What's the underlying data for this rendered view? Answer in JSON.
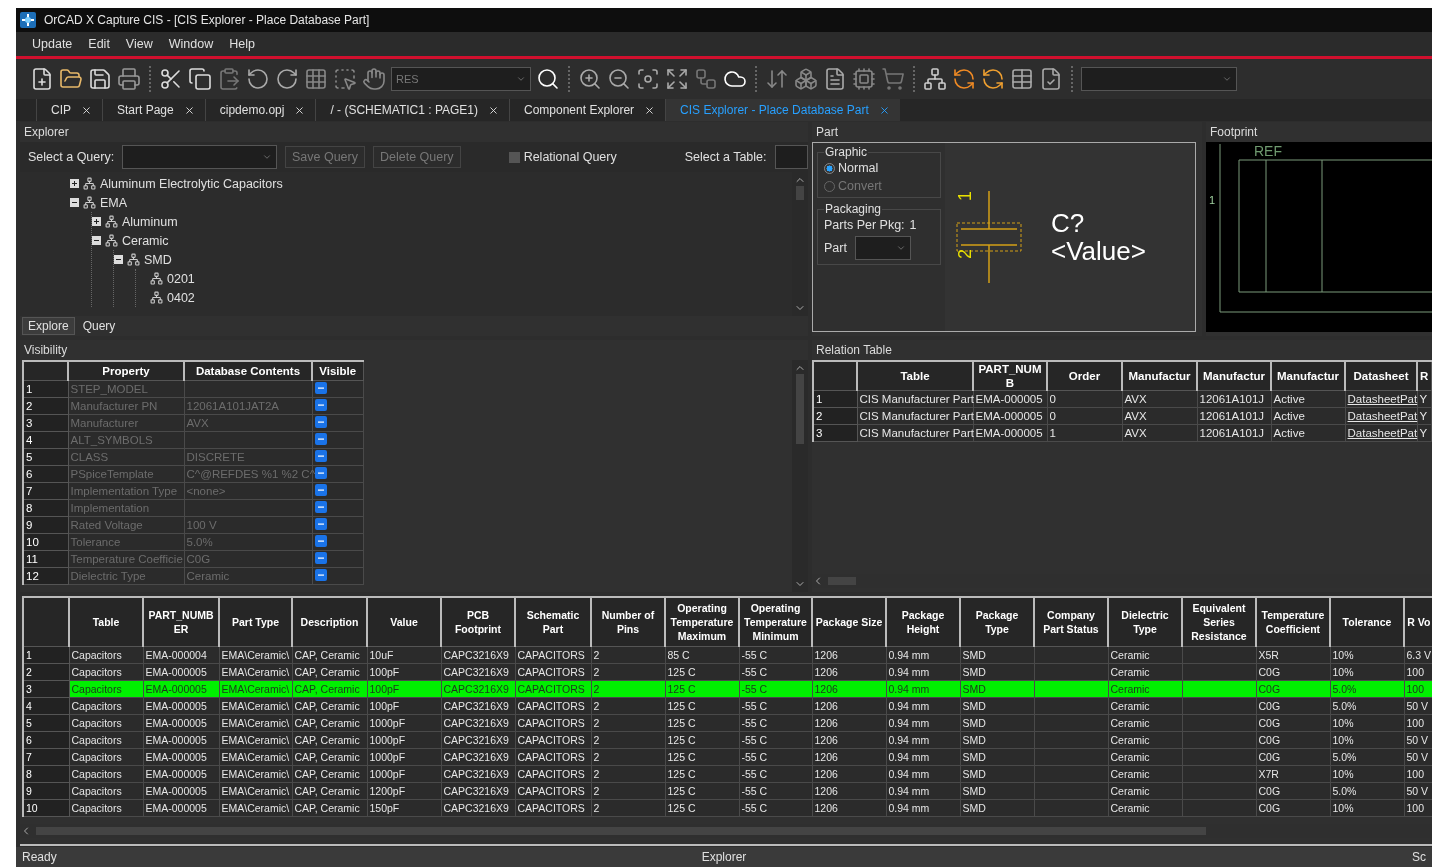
{
  "window": {
    "title": "OrCAD X Capture CIS - [CIS Explorer - Place Database Part]"
  },
  "menu": [
    "Update",
    "Edit",
    "View",
    "Window",
    "Help"
  ],
  "toolbar": {
    "search_value": "RES"
  },
  "tabs": [
    {
      "label": "CIP",
      "selected": false
    },
    {
      "label": "Start Page",
      "selected": false
    },
    {
      "label": "cipdemo.opj",
      "selected": false
    },
    {
      "label": "/ - (SCHEMATIC1 : PAGE1)",
      "selected": false
    },
    {
      "label": "Component Explorer",
      "selected": false
    },
    {
      "label": "CIS Explorer - Place Database Part",
      "selected": true
    }
  ],
  "explorer": {
    "title": "Explorer",
    "query_label": "Select a Query:",
    "buttons": [
      {
        "label": "Save Query",
        "disabled": true
      },
      {
        "label": "Delete Query",
        "disabled": true
      }
    ],
    "relational": {
      "label": "Relational Query",
      "checked": false
    },
    "table_label": "Select a Table:",
    "tree": [
      {
        "label": "Aluminum Electrolytic Capacitors",
        "expanded": false
      },
      {
        "label": "EMA",
        "expanded": true,
        "children": [
          {
            "label": "Aluminum",
            "expanded": false
          },
          {
            "label": "Ceramic",
            "expanded": true,
            "children": [
              {
                "label": "SMD",
                "expanded": true,
                "children": [
                  {
                    "label": "0201"
                  },
                  {
                    "label": "0402"
                  }
                ]
              }
            ]
          }
        ]
      }
    ],
    "bottom_tabs": [
      {
        "label": "Explore",
        "selected": true
      },
      {
        "label": "Query",
        "selected": false
      }
    ]
  },
  "part": {
    "title": "Part",
    "graphic": {
      "title": "Graphic",
      "options": [
        {
          "label": "Normal",
          "selected": true,
          "disabled": false
        },
        {
          "label": "Convert",
          "selected": false,
          "disabled": true
        }
      ]
    },
    "packaging": {
      "title": "Packaging",
      "parts_per_pkg_label": "Parts Per Pkg:",
      "parts_per_pkg": "1",
      "part_label": "Part"
    },
    "symbol": {
      "pin_1": "1",
      "pin_2": "2",
      "reference": "C?",
      "value": "<Value>"
    }
  },
  "footprint": {
    "title": "Footprint",
    "ref": "REF",
    "pin": "1"
  },
  "visibility": {
    "title": "Visibility",
    "columns": [
      "Property",
      "Database Contents",
      "Visible"
    ],
    "rows": [
      {
        "number": "1",
        "property": "STEP_MODEL",
        "checked": true
      },
      {
        "number": "2",
        "property": "Manufacturer PN",
        "contents": "12061A101JAT2A",
        "checked": true
      },
      {
        "number": "3",
        "property": "Manufacturer",
        "contents": "AVX",
        "checked": true
      },
      {
        "number": "4",
        "property": "ALT_SYMBOLS",
        "checked": true
      },
      {
        "number": "5",
        "property": "CLASS",
        "contents": "DISCRETE",
        "checked": true
      },
      {
        "number": "6",
        "property": "PSpiceTemplate",
        "contents": "C^@REFDES %1 %2 C^",
        "checked": true
      },
      {
        "number": "7",
        "property": "Implementation Type",
        "contents": "<none>",
        "checked": true
      },
      {
        "number": "8",
        "property": "Implementation",
        "checked": true
      },
      {
        "number": "9",
        "property": "Rated Voltage",
        "contents": "100 V",
        "checked": true
      },
      {
        "number": "10",
        "property": "Tolerance",
        "contents": "5.0%",
        "checked": true
      },
      {
        "number": "11",
        "property": "Temperature Coefficie",
        "contents": "C0G",
        "checked": true
      },
      {
        "number": "12",
        "property": "Dielectric Type",
        "contents": "Ceramic",
        "checked": true
      }
    ]
  },
  "relation_table": {
    "title": "Relation Table",
    "columns": [
      "Table",
      "PART_NUMB",
      "Order",
      "Manufactur",
      "Manufactur",
      "Manufactur",
      "Datasheet",
      "R"
    ],
    "rows": [
      {
        "number": "1",
        "table": "CIS Manufacturer Part",
        "part_number": "EMA-000005",
        "order": "0",
        "manufacturer": "AVX",
        "manufacturer_pn": "12061A101J",
        "status": "Active",
        "datasheet": "DatasheetPat",
        "column_9": "Y"
      },
      {
        "number": "2",
        "table": "CIS Manufacturer Part",
        "part_number": "EMA-000005",
        "order": "0",
        "manufacturer": "AVX",
        "manufacturer_pn": "12061A101J",
        "status": "Active",
        "datasheet": "DatasheetPat",
        "column_9": "Y"
      },
      {
        "number": "3",
        "table": "CIS Manufacturer Part",
        "part_number": "EMA-000005",
        "order": "1",
        "manufacturer": "AVX",
        "manufacturer_pn": "12061A101J",
        "status": "Active",
        "datasheet": "DatasheetPat",
        "column_9": "Y"
      }
    ]
  },
  "parts_table": {
    "columns": [
      "Table",
      "PART_NUMBER",
      "Part Type",
      "Description",
      "Value",
      "PCB Footprint",
      "Schematic Part",
      "Number of Pins",
      "Operating Temperature Maximum",
      "Operating Temperature Minimum",
      "Package Size",
      "Package Height",
      "Package Type",
      "Company Part Status",
      "Dielectric Type",
      "Equivalent Series Resistance",
      "Temperature Coefficient",
      "Tolerance",
      "R Vo"
    ],
    "rows": [
      {
        "number": "1",
        "selected": false,
        "cells": [
          "Capacitors",
          "EMA-000004",
          "EMA\\Ceramic\\",
          "CAP, Ceramic",
          "10uF",
          "CAPC3216X9",
          "CAPACITORS",
          "2",
          "85 C",
          "-55 C",
          "1206",
          "0.94 mm",
          "SMD",
          null,
          "Ceramic",
          null,
          "X5R",
          "10%",
          "6.3 V"
        ]
      },
      {
        "number": "2",
        "selected": false,
        "cells": [
          "Capacitors",
          "EMA-000005",
          "EMA\\Ceramic\\",
          "CAP, Ceramic",
          "100pF",
          "CAPC3216X9",
          "CAPACITORS",
          "2",
          "125 C",
          "-55 C",
          "1206",
          "0.94 mm",
          "SMD",
          null,
          "Ceramic",
          null,
          "C0G",
          "10%",
          "100"
        ]
      },
      {
        "number": "3",
        "selected": true,
        "cells": [
          "Capacitors",
          "EMA-000005",
          "EMA\\Ceramic\\",
          "CAP, Ceramic",
          "100pF",
          "CAPC3216X9",
          "CAPACITORS",
          "2",
          "125 C",
          "-55 C",
          "1206",
          "0.94 mm",
          "SMD",
          null,
          "Ceramic",
          null,
          "C0G",
          "5.0%",
          "100"
        ]
      },
      {
        "number": "4",
        "selected": false,
        "cells": [
          "Capacitors",
          "EMA-000005",
          "EMA\\Ceramic\\",
          "CAP, Ceramic",
          "100pF",
          "CAPC3216X9",
          "CAPACITORS",
          "2",
          "125 C",
          "-55 C",
          "1206",
          "0.94 mm",
          "SMD",
          null,
          "Ceramic",
          null,
          "C0G",
          "5.0%",
          "50 V"
        ]
      },
      {
        "number": "5",
        "selected": false,
        "cells": [
          "Capacitors",
          "EMA-000005",
          "EMA\\Ceramic\\",
          "CAP, Ceramic",
          "1000pF",
          "CAPC3216X9",
          "CAPACITORS",
          "2",
          "125 C",
          "-55 C",
          "1206",
          "0.94 mm",
          "SMD",
          null,
          "Ceramic",
          null,
          "C0G",
          "10%",
          "100"
        ]
      },
      {
        "number": "6",
        "selected": false,
        "cells": [
          "Capacitors",
          "EMA-000005",
          "EMA\\Ceramic\\",
          "CAP, Ceramic",
          "1000pF",
          "CAPC3216X9",
          "CAPACITORS",
          "2",
          "125 C",
          "-55 C",
          "1206",
          "0.94 mm",
          "SMD",
          null,
          "Ceramic",
          null,
          "C0G",
          "10%",
          "50 V"
        ]
      },
      {
        "number": "7",
        "selected": false,
        "cells": [
          "Capacitors",
          "EMA-000005",
          "EMA\\Ceramic\\",
          "CAP, Ceramic",
          "1000pF",
          "CAPC3216X9",
          "CAPACITORS",
          "2",
          "125 C",
          "-55 C",
          "1206",
          "0.94 mm",
          "SMD",
          null,
          "Ceramic",
          null,
          "C0G",
          "5.0%",
          "50 V"
        ]
      },
      {
        "number": "8",
        "selected": false,
        "cells": [
          "Capacitors",
          "EMA-000005",
          "EMA\\Ceramic\\",
          "CAP, Ceramic",
          "1000pF",
          "CAPC3216X9",
          "CAPACITORS",
          "2",
          "125 C",
          "-55 C",
          "1206",
          "0.94 mm",
          "SMD",
          null,
          "Ceramic",
          null,
          "X7R",
          "10%",
          "100"
        ]
      },
      {
        "number": "9",
        "selected": false,
        "cells": [
          "Capacitors",
          "EMA-000005",
          "EMA\\Ceramic\\",
          "CAP, Ceramic",
          "1200pF",
          "CAPC3216X9",
          "CAPACITORS",
          "2",
          "125 C",
          "-55 C",
          "1206",
          "0.94 mm",
          "SMD",
          null,
          "Ceramic",
          null,
          "C0G",
          "5.0%",
          "50 V"
        ]
      },
      {
        "number": "10",
        "selected": false,
        "cells": [
          "Capacitors",
          "EMA-000005",
          "EMA\\Ceramic\\",
          "CAP, Ceramic",
          "150pF",
          "CAPC3216X9",
          "CAPACITORS",
          "2",
          "125 C",
          "-55 C",
          "1206",
          "0.94 mm",
          "SMD",
          null,
          "Ceramic",
          null,
          "C0G",
          "10%",
          "100"
        ]
      }
    ]
  },
  "status_bar": {
    "left": "Ready",
    "center": "Explorer",
    "right": "Sc"
  }
}
